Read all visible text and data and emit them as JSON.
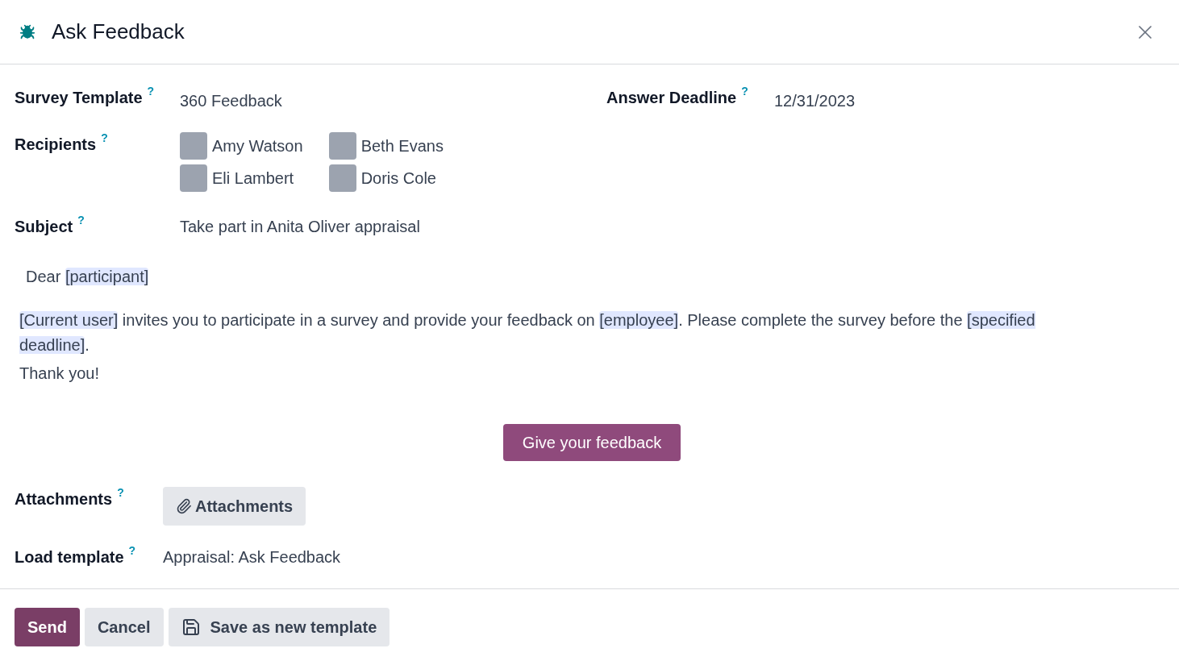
{
  "dialog": {
    "title": "Ask Feedback"
  },
  "fields": {
    "survey_template": {
      "label": "Survey Template",
      "help": "?",
      "value": "360 Feedback"
    },
    "answer_deadline": {
      "label": "Answer Deadline",
      "help": "?",
      "value": "12/31/2023"
    },
    "recipients": {
      "label": "Recipients",
      "help": "?",
      "people": [
        {
          "name": "Amy Watson"
        },
        {
          "name": "Beth Evans"
        },
        {
          "name": "Eli Lambert"
        },
        {
          "name": "Doris Cole"
        }
      ]
    },
    "subject": {
      "label": "Subject",
      "help": "?",
      "value": "Take part in Anita Oliver appraisal"
    }
  },
  "body": {
    "greeting": [
      {
        "kind": "text",
        "text": "Dear "
      },
      {
        "kind": "placeholder",
        "text": "[participant]"
      }
    ],
    "paragraph": [
      {
        "kind": "placeholder",
        "text": "[Current user]"
      },
      {
        "kind": "text",
        "text": " invites you to participate in a survey and provide your feedback on "
      },
      {
        "kind": "placeholder",
        "text": "[employee]"
      },
      {
        "kind": "text",
        "text": ". Please complete the survey before the "
      },
      {
        "kind": "placeholder",
        "text": "[specified deadline]"
      },
      {
        "kind": "text",
        "text": "."
      }
    ],
    "closing": "Thank you!",
    "cta": "Give your feedback"
  },
  "attachments": {
    "label": "Attachments",
    "help": "?",
    "button": "Attachments"
  },
  "load_template": {
    "label": "Load template",
    "help": "?",
    "value": "Appraisal: Ask Feedback"
  },
  "footer": {
    "buttons": [
      {
        "kind": "primary",
        "label": "Send"
      },
      {
        "kind": "secondary",
        "label": "Cancel"
      },
      {
        "kind": "save",
        "label": "Save as new template"
      }
    ]
  }
}
